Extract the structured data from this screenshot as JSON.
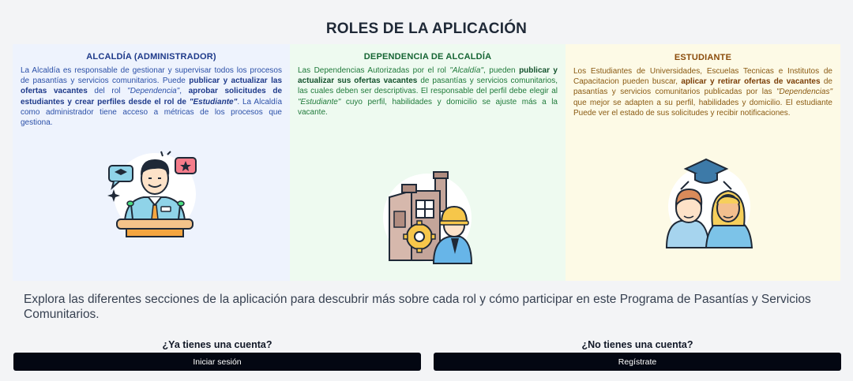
{
  "page_title": "ROLES DE LA APLICACIÓN",
  "roles": [
    {
      "title": "ALCALDÍA (ADMINISTRADOR)",
      "segments": [
        {
          "t": "La Alcaldía es responsable de gestionar y supervisar todos los procesos de pasantías y servicios comunitarios. Puede ",
          "s": ""
        },
        {
          "t": "publicar y actualizar las ofertas vacantes",
          "s": "b"
        },
        {
          "t": " del rol ",
          "s": ""
        },
        {
          "t": "\"Dependencia\"",
          "s": "i"
        },
        {
          "t": ", ",
          "s": ""
        },
        {
          "t": "aprobar solicitudes de estudiantes y crear perfiles desde el rol de ",
          "s": "b"
        },
        {
          "t": "\"Estudiante\"",
          "s": "bi"
        },
        {
          "t": ". La Alcaldía como administrador tiene acceso a métricas de los procesos que gestiona.",
          "s": ""
        }
      ]
    },
    {
      "title": "DEPENDENCIA DE ALCALDÍA",
      "segments": [
        {
          "t": "Las Dependencias Autorizadas por el rol ",
          "s": ""
        },
        {
          "t": "\"Alcaldía\"",
          "s": "i"
        },
        {
          "t": ", pueden ",
          "s": ""
        },
        {
          "t": "publicar y actualizar sus ofertas vacantes",
          "s": "b"
        },
        {
          "t": " de pasantías y servicios comunitarios, las cuales deben ser descriptivas. El responsable del perfil debe elegir al ",
          "s": ""
        },
        {
          "t": "\"Estudiante\"",
          "s": "i"
        },
        {
          "t": " cuyo perfil, habilidades y domicilio se ajuste más a la vacante.",
          "s": ""
        }
      ]
    },
    {
      "title": "ESTUDIANTE",
      "segments": [
        {
          "t": "Los Estudiantes de Universidades, Escuelas Tecnicas e Institutos de Capacitacion pueden buscar, ",
          "s": ""
        },
        {
          "t": "aplicar y retirar ofertas de vacantes",
          "s": "b"
        },
        {
          "t": " de pasantías y servicios comunitarios publicadas por las ",
          "s": ""
        },
        {
          "t": "\"Dependencias\"",
          "s": "i"
        },
        {
          "t": " que mejor se adapten a su perfil, habilidades y domicilio. El estudiante Puede ver el estado de sus solicitudes y recibir notificaciones.",
          "s": ""
        }
      ]
    }
  ],
  "intro": "Explora las diferentes secciones de la aplicación para descubrir más sobre cada rol y cómo participar en este Programa de Pasantías y Servicios Comunitarios.",
  "login": {
    "question": "¿Ya tienes una cuenta?",
    "button": "Iniciar sesión"
  },
  "register": {
    "question": "¿No tienes una cuenta?",
    "button": "Regístrate"
  }
}
